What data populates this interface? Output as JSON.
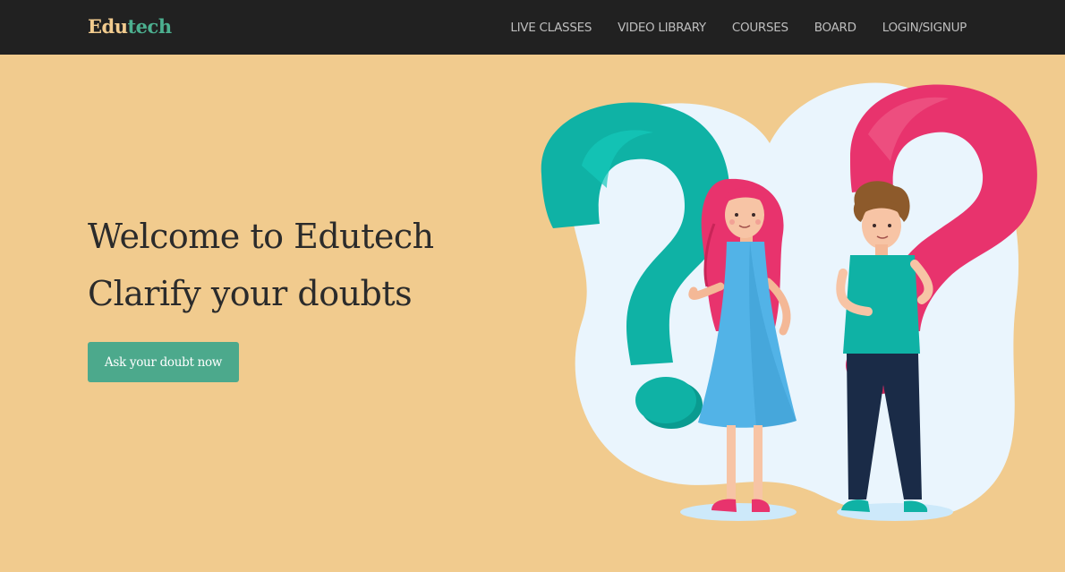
{
  "brand": {
    "part1": "Edu",
    "part2": "tech"
  },
  "nav": {
    "items": [
      {
        "label": "LIVE CLASSES"
      },
      {
        "label": "VIDEO LIBRARY"
      },
      {
        "label": "COURSES"
      },
      {
        "label": "BOARD"
      },
      {
        "label": "LOGIN/SIGNUP"
      }
    ]
  },
  "hero": {
    "line1": "Welcome to Edutech",
    "line2": "Clarify your doubts",
    "cta_label": "Ask your doubt now"
  },
  "colors": {
    "navbar_bg": "#212121",
    "page_bg": "#f1cb8e",
    "accent_green": "#4ca98c",
    "teal": "#0fb2a5",
    "pink": "#e8336d"
  },
  "illustration": {
    "icon": "question-marks-people-illustration"
  }
}
